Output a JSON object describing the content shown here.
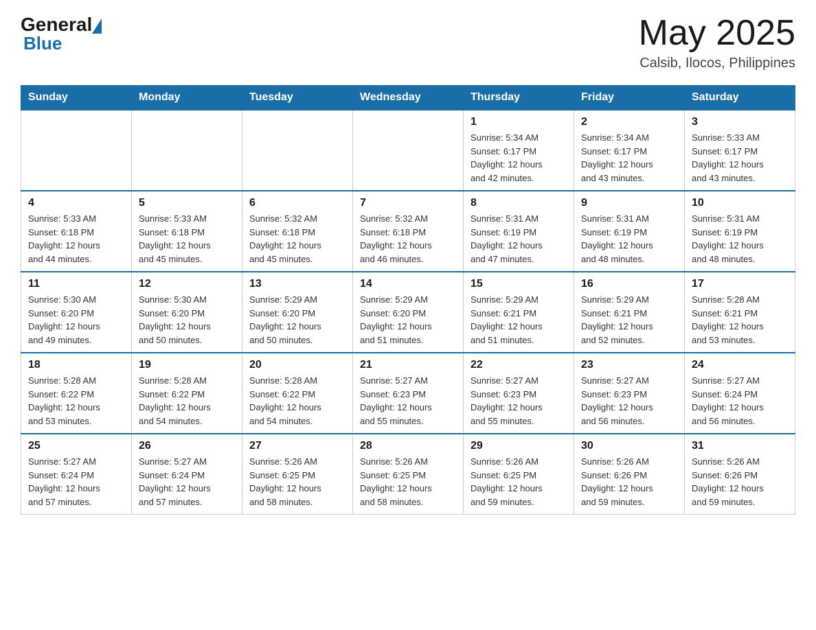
{
  "header": {
    "logo_general": "General",
    "logo_blue": "Blue",
    "month_year": "May 2025",
    "location": "Calsib, Ilocos, Philippines"
  },
  "days_of_week": [
    "Sunday",
    "Monday",
    "Tuesday",
    "Wednesday",
    "Thursday",
    "Friday",
    "Saturday"
  ],
  "weeks": [
    [
      {
        "day": "",
        "info": ""
      },
      {
        "day": "",
        "info": ""
      },
      {
        "day": "",
        "info": ""
      },
      {
        "day": "",
        "info": ""
      },
      {
        "day": "1",
        "info": "Sunrise: 5:34 AM\nSunset: 6:17 PM\nDaylight: 12 hours\nand 42 minutes."
      },
      {
        "day": "2",
        "info": "Sunrise: 5:34 AM\nSunset: 6:17 PM\nDaylight: 12 hours\nand 43 minutes."
      },
      {
        "day": "3",
        "info": "Sunrise: 5:33 AM\nSunset: 6:17 PM\nDaylight: 12 hours\nand 43 minutes."
      }
    ],
    [
      {
        "day": "4",
        "info": "Sunrise: 5:33 AM\nSunset: 6:18 PM\nDaylight: 12 hours\nand 44 minutes."
      },
      {
        "day": "5",
        "info": "Sunrise: 5:33 AM\nSunset: 6:18 PM\nDaylight: 12 hours\nand 45 minutes."
      },
      {
        "day": "6",
        "info": "Sunrise: 5:32 AM\nSunset: 6:18 PM\nDaylight: 12 hours\nand 45 minutes."
      },
      {
        "day": "7",
        "info": "Sunrise: 5:32 AM\nSunset: 6:18 PM\nDaylight: 12 hours\nand 46 minutes."
      },
      {
        "day": "8",
        "info": "Sunrise: 5:31 AM\nSunset: 6:19 PM\nDaylight: 12 hours\nand 47 minutes."
      },
      {
        "day": "9",
        "info": "Sunrise: 5:31 AM\nSunset: 6:19 PM\nDaylight: 12 hours\nand 48 minutes."
      },
      {
        "day": "10",
        "info": "Sunrise: 5:31 AM\nSunset: 6:19 PM\nDaylight: 12 hours\nand 48 minutes."
      }
    ],
    [
      {
        "day": "11",
        "info": "Sunrise: 5:30 AM\nSunset: 6:20 PM\nDaylight: 12 hours\nand 49 minutes."
      },
      {
        "day": "12",
        "info": "Sunrise: 5:30 AM\nSunset: 6:20 PM\nDaylight: 12 hours\nand 50 minutes."
      },
      {
        "day": "13",
        "info": "Sunrise: 5:29 AM\nSunset: 6:20 PM\nDaylight: 12 hours\nand 50 minutes."
      },
      {
        "day": "14",
        "info": "Sunrise: 5:29 AM\nSunset: 6:20 PM\nDaylight: 12 hours\nand 51 minutes."
      },
      {
        "day": "15",
        "info": "Sunrise: 5:29 AM\nSunset: 6:21 PM\nDaylight: 12 hours\nand 51 minutes."
      },
      {
        "day": "16",
        "info": "Sunrise: 5:29 AM\nSunset: 6:21 PM\nDaylight: 12 hours\nand 52 minutes."
      },
      {
        "day": "17",
        "info": "Sunrise: 5:28 AM\nSunset: 6:21 PM\nDaylight: 12 hours\nand 53 minutes."
      }
    ],
    [
      {
        "day": "18",
        "info": "Sunrise: 5:28 AM\nSunset: 6:22 PM\nDaylight: 12 hours\nand 53 minutes."
      },
      {
        "day": "19",
        "info": "Sunrise: 5:28 AM\nSunset: 6:22 PM\nDaylight: 12 hours\nand 54 minutes."
      },
      {
        "day": "20",
        "info": "Sunrise: 5:28 AM\nSunset: 6:22 PM\nDaylight: 12 hours\nand 54 minutes."
      },
      {
        "day": "21",
        "info": "Sunrise: 5:27 AM\nSunset: 6:23 PM\nDaylight: 12 hours\nand 55 minutes."
      },
      {
        "day": "22",
        "info": "Sunrise: 5:27 AM\nSunset: 6:23 PM\nDaylight: 12 hours\nand 55 minutes."
      },
      {
        "day": "23",
        "info": "Sunrise: 5:27 AM\nSunset: 6:23 PM\nDaylight: 12 hours\nand 56 minutes."
      },
      {
        "day": "24",
        "info": "Sunrise: 5:27 AM\nSunset: 6:24 PM\nDaylight: 12 hours\nand 56 minutes."
      }
    ],
    [
      {
        "day": "25",
        "info": "Sunrise: 5:27 AM\nSunset: 6:24 PM\nDaylight: 12 hours\nand 57 minutes."
      },
      {
        "day": "26",
        "info": "Sunrise: 5:27 AM\nSunset: 6:24 PM\nDaylight: 12 hours\nand 57 minutes."
      },
      {
        "day": "27",
        "info": "Sunrise: 5:26 AM\nSunset: 6:25 PM\nDaylight: 12 hours\nand 58 minutes."
      },
      {
        "day": "28",
        "info": "Sunrise: 5:26 AM\nSunset: 6:25 PM\nDaylight: 12 hours\nand 58 minutes."
      },
      {
        "day": "29",
        "info": "Sunrise: 5:26 AM\nSunset: 6:25 PM\nDaylight: 12 hours\nand 59 minutes."
      },
      {
        "day": "30",
        "info": "Sunrise: 5:26 AM\nSunset: 6:26 PM\nDaylight: 12 hours\nand 59 minutes."
      },
      {
        "day": "31",
        "info": "Sunrise: 5:26 AM\nSunset: 6:26 PM\nDaylight: 12 hours\nand 59 minutes."
      }
    ]
  ]
}
